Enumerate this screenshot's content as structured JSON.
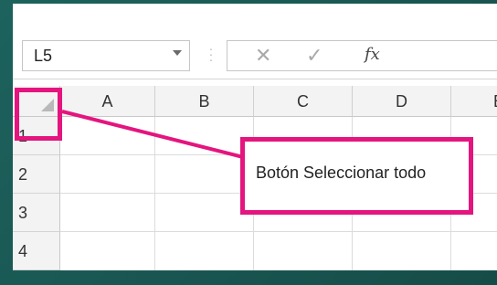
{
  "formula_bar": {
    "name_box_value": "L5",
    "cancel_glyph": "✕",
    "enter_glyph": "✓",
    "function_glyph": "fx",
    "formula_value": ""
  },
  "grid": {
    "columns": [
      "A",
      "B",
      "C",
      "D",
      "E"
    ],
    "rows": [
      "1",
      "2",
      "3",
      "4"
    ]
  },
  "annotation": {
    "callout_text": "Botón Seleccionar todo",
    "accent_color": "#e4157f"
  },
  "icons": {
    "select_all": "triangle-corner-icon",
    "dropdown": "chevron-down-icon",
    "cancel": "close-icon",
    "enter": "check-icon",
    "function": "fx-icon"
  }
}
